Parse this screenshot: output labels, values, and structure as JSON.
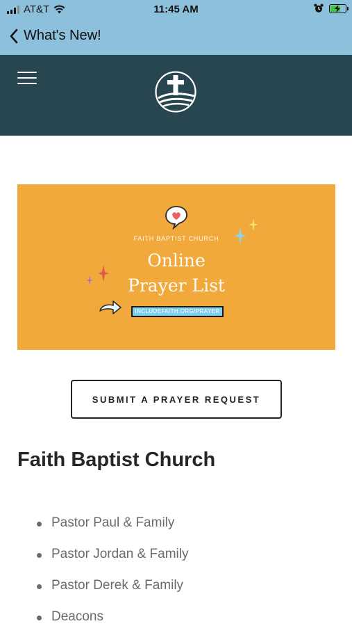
{
  "status_bar": {
    "carrier": "AT&T",
    "time": "11:45 AM"
  },
  "nav": {
    "back_label": "What's New!"
  },
  "banner": {
    "church_name": "FAITH BAPTIST CHURCH",
    "title_line1": "Online",
    "title_line2": "Prayer List",
    "url": "INCLUDEFAITH.ORG/PRAYER"
  },
  "actions": {
    "submit_label": "SUBMIT A PRAYER REQUEST"
  },
  "section": {
    "title": "Faith Baptist Church",
    "items": [
      "Pastor Paul & Family",
      "Pastor Jordan & Family",
      "Pastor Derek & Family",
      "Deacons"
    ]
  }
}
